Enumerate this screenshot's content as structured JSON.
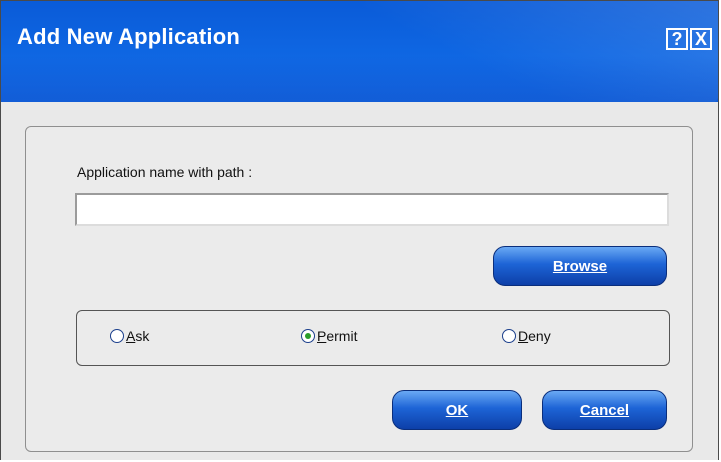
{
  "window": {
    "title": "Add New Application",
    "help_label": "?",
    "close_label": "X"
  },
  "form": {
    "path_label": "Application name with path  :",
    "path_value": "",
    "browse_label": "Browse",
    "ok_label": "OK",
    "cancel_label": "Cancel"
  },
  "radio": {
    "options": [
      {
        "label": "Ask",
        "checked": false
      },
      {
        "label": "Permit",
        "checked": true
      },
      {
        "label": "Deny",
        "checked": false
      }
    ]
  },
  "colors": {
    "titlebar": "#0f67e3",
    "button": "#1d64d6",
    "radio_check": "#2a9d2a"
  },
  "icons": {
    "help": "help-icon",
    "close": "close-icon"
  }
}
